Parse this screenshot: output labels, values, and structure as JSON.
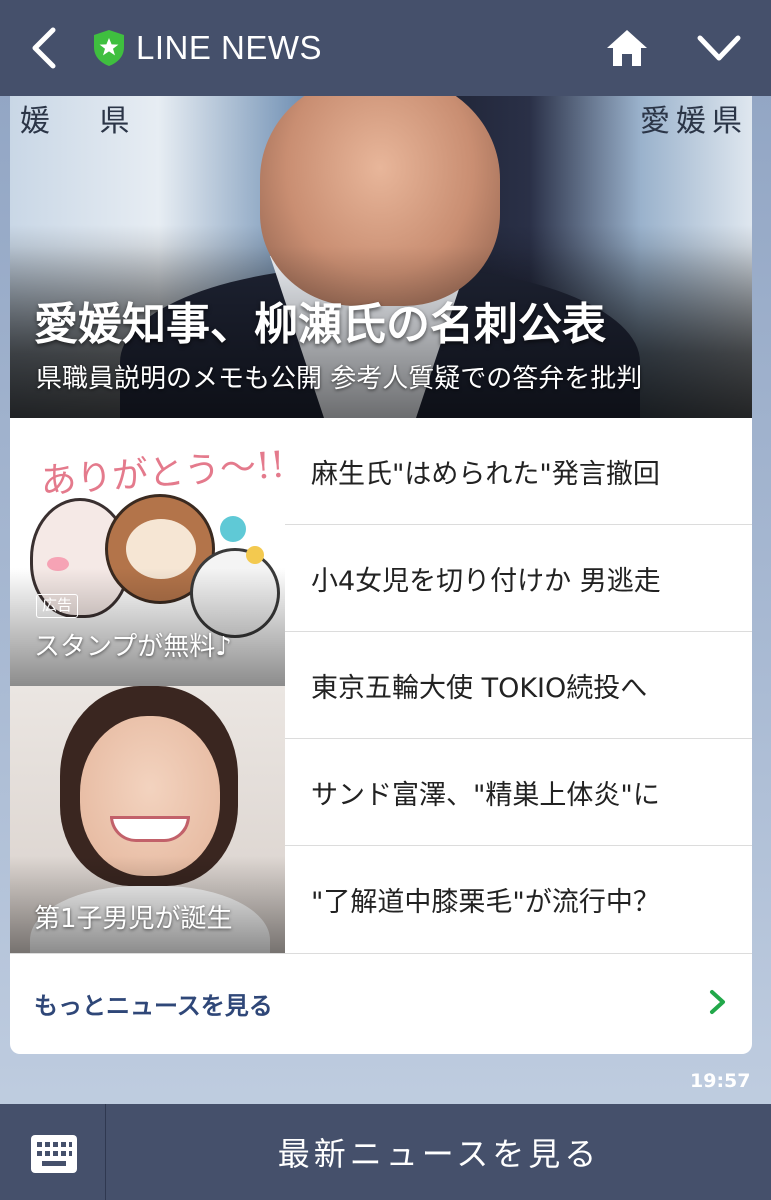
{
  "header": {
    "title": "LINE NEWS",
    "back_icon": "chevron-left-icon",
    "home_icon": "home-icon",
    "menu_icon": "chevron-down-icon",
    "logo_icon": "shield-star-icon"
  },
  "hero": {
    "headline": "愛媛知事、柳瀬氏の名刺公表",
    "subheadline": "県職員説明のメモも公開 参考人質疑での答弁を批判",
    "sign_left": "媛 県",
    "sign_right": "愛媛県"
  },
  "ad": {
    "title_art": "ありがとう～!!",
    "badge": "広告",
    "caption": "スタンプが無料♪"
  },
  "person": {
    "caption": "第1子男児が誕生"
  },
  "headlines": [
    {
      "label": "麻生氏\"はめられた\"発言撤回"
    },
    {
      "label": "小4女児を切り付けか 男逃走"
    },
    {
      "label": "東京五輪大使 TOKIO続投へ"
    },
    {
      "label": "サンド富澤、\"精巣上体炎\"に"
    },
    {
      "label": "\"了解道中膝栗毛\"が流行中？"
    }
  ],
  "more": {
    "label": "もっとニュースを見る",
    "icon": "chevron-right-icon"
  },
  "timestamp": "19:57",
  "bottom_bar": {
    "keyboard_icon": "keyboard-icon",
    "action_label": "最新ニュースを見る"
  },
  "colors": {
    "header_bg": "#45506b",
    "logo_green": "#3fbf3f",
    "more_link": "#2f4778",
    "chevron_green": "#22a84a"
  }
}
